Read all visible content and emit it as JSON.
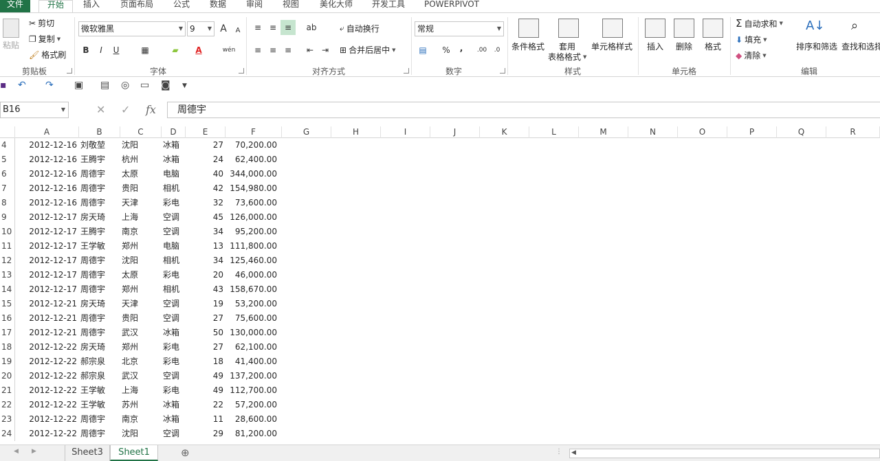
{
  "tabs": [
    "文件",
    "开始",
    "插入",
    "页面布局",
    "公式",
    "数据",
    "审阅",
    "视图",
    "美化大师",
    "开发工具",
    "POWERPIVOT"
  ],
  "clipboard": {
    "paste": "粘贴",
    "cut": "剪切",
    "copy": "复制",
    "format_painter": "格式刷",
    "group": "剪贴板"
  },
  "font": {
    "name": "微软雅黑",
    "size": "9",
    "bold": "B",
    "italic": "I",
    "underline": "U",
    "group": "字体",
    "increase": "A",
    "decrease": "A",
    "font_color_glyph": "A",
    "phonetic": "wén"
  },
  "alignment": {
    "wrap": "自动换行",
    "merge": "合并后居中",
    "group": "对齐方式"
  },
  "number": {
    "format": "常规",
    "percent": "%",
    "comma": ",",
    "group": "数字",
    "inc_decimal": ".00",
    "dec_decimal": ".0"
  },
  "styles": {
    "conditional": "条件格式",
    "table_format_1": "套用",
    "table_format_2": "表格格式",
    "cell_styles": "单元格样式",
    "group": "样式"
  },
  "cells": {
    "insert": "插入",
    "delete": "删除",
    "format": "格式",
    "group": "单元格"
  },
  "editing": {
    "autosum": "自动求和",
    "fill": "填充",
    "clear": "清除",
    "sort": "排序和筛选",
    "find": "查找和选择",
    "group": "编辑"
  },
  "namebox": "B16",
  "formula": "周德宇",
  "fx": "fx",
  "columns": [
    "A",
    "B",
    "C",
    "D",
    "E",
    "F",
    "G",
    "H",
    "I",
    "J",
    "K",
    "L",
    "M",
    "N",
    "O",
    "P",
    "Q",
    "R"
  ],
  "rows": [
    {
      "n": "4",
      "date": "2012-12-16",
      "name": "刘敬堃",
      "city": "沈阳",
      "item": "冰箱",
      "qty": "27",
      "amt": "70,200.00"
    },
    {
      "n": "5",
      "date": "2012-12-16",
      "name": "王腾宇",
      "city": "杭州",
      "item": "冰箱",
      "qty": "24",
      "amt": "62,400.00"
    },
    {
      "n": "6",
      "date": "2012-12-16",
      "name": "周德宇",
      "city": "太原",
      "item": "电脑",
      "qty": "40",
      "amt": "344,000.00"
    },
    {
      "n": "7",
      "date": "2012-12-16",
      "name": "周德宇",
      "city": "贵阳",
      "item": "相机",
      "qty": "42",
      "amt": "154,980.00"
    },
    {
      "n": "8",
      "date": "2012-12-16",
      "name": "周德宇",
      "city": "天津",
      "item": "彩电",
      "qty": "32",
      "amt": "73,600.00"
    },
    {
      "n": "9",
      "date": "2012-12-17",
      "name": "房天琦",
      "city": "上海",
      "item": "空调",
      "qty": "45",
      "amt": "126,000.00"
    },
    {
      "n": "10",
      "date": "2012-12-17",
      "name": "王腾宇",
      "city": "南京",
      "item": "空调",
      "qty": "34",
      "amt": "95,200.00"
    },
    {
      "n": "11",
      "date": "2012-12-17",
      "name": "王学敏",
      "city": "郑州",
      "item": "电脑",
      "qty": "13",
      "amt": "111,800.00"
    },
    {
      "n": "12",
      "date": "2012-12-17",
      "name": "周德宇",
      "city": "沈阳",
      "item": "相机",
      "qty": "34",
      "amt": "125,460.00"
    },
    {
      "n": "13",
      "date": "2012-12-17",
      "name": "周德宇",
      "city": "太原",
      "item": "彩电",
      "qty": "20",
      "amt": "46,000.00"
    },
    {
      "n": "14",
      "date": "2012-12-17",
      "name": "周德宇",
      "city": "郑州",
      "item": "相机",
      "qty": "43",
      "amt": "158,670.00"
    },
    {
      "n": "15",
      "date": "2012-12-21",
      "name": "房天琦",
      "city": "天津",
      "item": "空调",
      "qty": "19",
      "amt": "53,200.00"
    },
    {
      "n": "16",
      "date": "2012-12-21",
      "name": "周德宇",
      "city": "贵阳",
      "item": "空调",
      "qty": "27",
      "amt": "75,600.00"
    },
    {
      "n": "17",
      "date": "2012-12-21",
      "name": "周德宇",
      "city": "武汉",
      "item": "冰箱",
      "qty": "50",
      "amt": "130,000.00"
    },
    {
      "n": "18",
      "date": "2012-12-22",
      "name": "房天琦",
      "city": "郑州",
      "item": "彩电",
      "qty": "27",
      "amt": "62,100.00"
    },
    {
      "n": "19",
      "date": "2012-12-22",
      "name": "郝宗泉",
      "city": "北京",
      "item": "彩电",
      "qty": "18",
      "amt": "41,400.00"
    },
    {
      "n": "20",
      "date": "2012-12-22",
      "name": "郝宗泉",
      "city": "武汉",
      "item": "空调",
      "qty": "49",
      "amt": "137,200.00"
    },
    {
      "n": "21",
      "date": "2012-12-22",
      "name": "王学敏",
      "city": "上海",
      "item": "彩电",
      "qty": "49",
      "amt": "112,700.00"
    },
    {
      "n": "22",
      "date": "2012-12-22",
      "name": "王学敏",
      "city": "苏州",
      "item": "冰箱",
      "qty": "22",
      "amt": "57,200.00"
    },
    {
      "n": "23",
      "date": "2012-12-22",
      "name": "周德宇",
      "city": "南京",
      "item": "冰箱",
      "qty": "11",
      "amt": "28,600.00"
    },
    {
      "n": "24",
      "date": "2012-12-22",
      "name": "周德宇",
      "city": "沈阳",
      "item": "空调",
      "qty": "29",
      "amt": "81,200.00"
    }
  ],
  "sheets": [
    "Sheet3",
    "Sheet1"
  ],
  "active_sheet": "Sheet1",
  "colors": {
    "accent": "#217346"
  }
}
